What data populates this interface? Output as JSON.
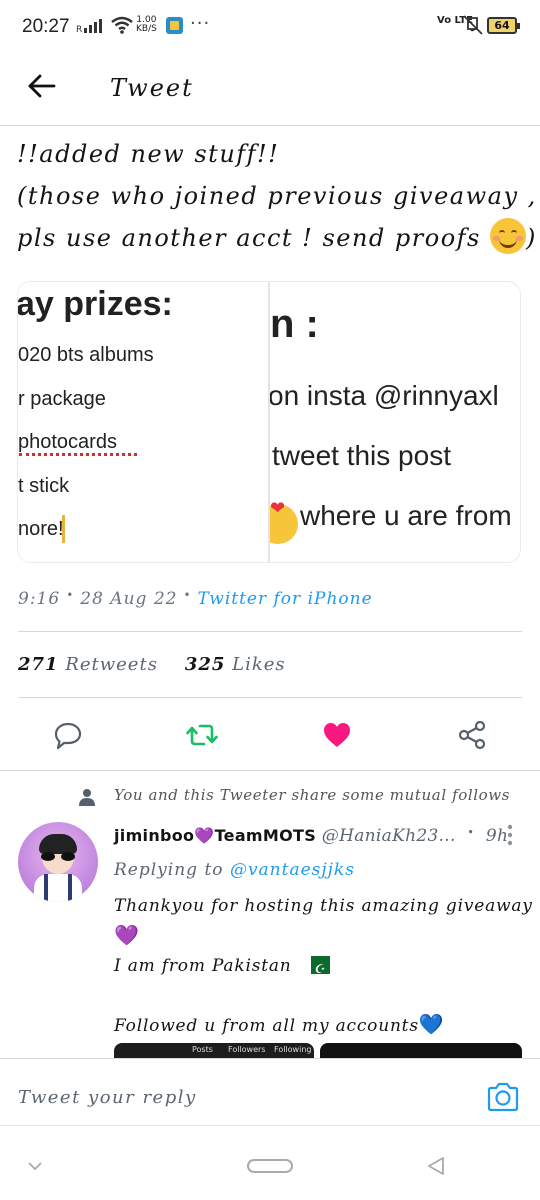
{
  "status_bar": {
    "time": "20:27",
    "speed_value": "1.00",
    "speed_unit": "KB/S",
    "network": "Vo LTE",
    "battery": "64"
  },
  "header": {
    "title": "Tweet"
  },
  "tweet": {
    "lines": [
      "!!added new stuff!!",
      "(those who joined previous giveaway ,",
      "pls use another acct ! send proofs"
    ],
    "closing": ")",
    "media": {
      "image1": {
        "heading": "ay prizes:",
        "items": [
          "020 bts albums",
          "r package",
          "photocards",
          "t stick",
          "nore!"
        ]
      },
      "image2": {
        "heading": "n :",
        "items": [
          "on insta @rinnyaxl",
          "tweet this post",
          "where u are from"
        ]
      }
    },
    "time": "9:16",
    "date": "28 Aug 22",
    "source": "Twitter for iPhone",
    "retweets_count": "271",
    "retweets_label": "Retweets",
    "likes_count": "325",
    "likes_label": "Likes"
  },
  "colors": {
    "accent_blue": "#1d9bf0",
    "retweet_green": "#17bf63",
    "like_pink": "#f91880"
  },
  "reply": {
    "social_context": "You and this Tweeter share some mutual follows",
    "name_prefix": "jiminboo",
    "name_suffix": "TeamMOTS",
    "handle": "@HaniaKh23...",
    "time": "9h",
    "replying_label": "Replying to",
    "replying_to": "@vantaesjjks",
    "body_line1": "Thankyou for hosting this amazing giveaway",
    "body_line3": "I am from Pakistan",
    "body_line5": "Followed u from all my accounts",
    "media_labels": [
      "Posts",
      "Followers",
      "Following"
    ]
  },
  "compose": {
    "placeholder": "Tweet your reply"
  }
}
